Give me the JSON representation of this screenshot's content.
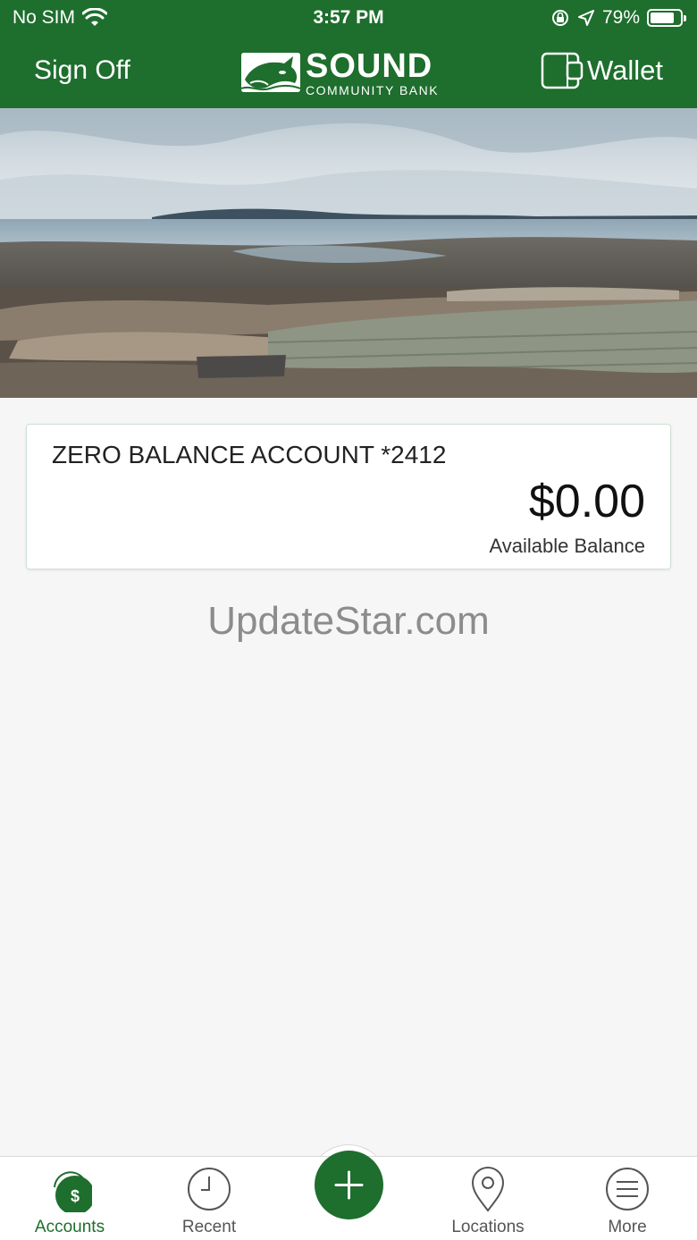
{
  "status_bar": {
    "carrier": "No SIM",
    "time": "3:57 PM",
    "battery_percent": "79%",
    "battery_level": 0.79
  },
  "header": {
    "sign_off_label": "Sign Off",
    "logo_main": "SOUND",
    "logo_sub": "COMMUNITY BANK",
    "wallet_label": "Wallet",
    "brand_color": "#1e6e2d"
  },
  "account": {
    "name": "ZERO BALANCE ACCOUNT *2412",
    "balance": "$0.00",
    "balance_label": "Available Balance"
  },
  "watermark": "UpdateStar.com",
  "tabs": [
    {
      "label": "Accounts",
      "icon": "dollar-icon",
      "active": true
    },
    {
      "label": "Recent",
      "icon": "clock-icon",
      "active": false
    },
    {
      "label": "",
      "icon": "plus-icon",
      "active": false
    },
    {
      "label": "Locations",
      "icon": "map-pin-icon",
      "active": false
    },
    {
      "label": "More",
      "icon": "menu-icon",
      "active": false
    }
  ]
}
